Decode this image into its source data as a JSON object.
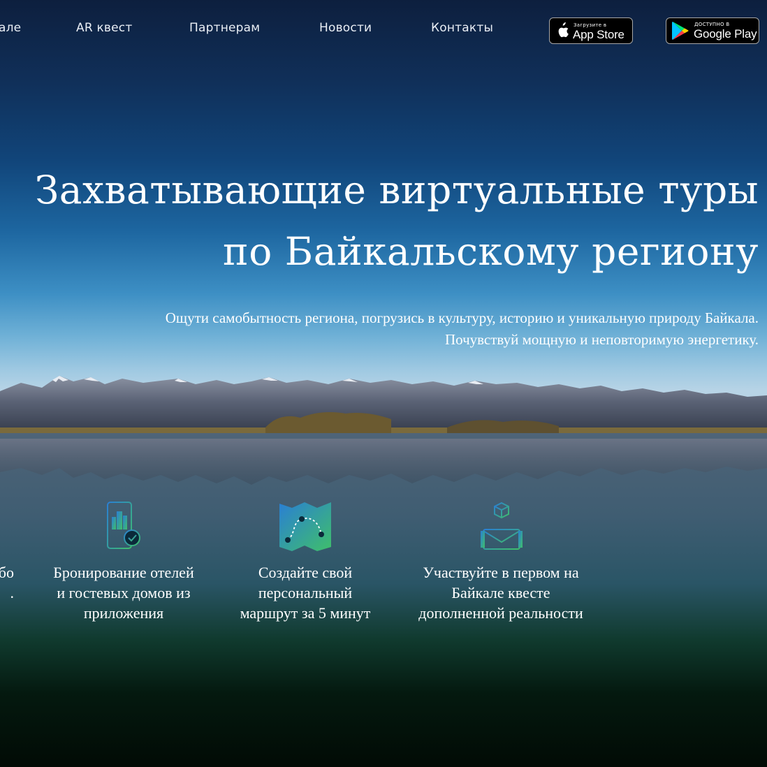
{
  "nav": {
    "links": [
      {
        "label": "але"
      },
      {
        "label": "AR квест"
      },
      {
        "label": "Партнерам"
      },
      {
        "label": "Новости"
      },
      {
        "label": "Контакты"
      }
    ],
    "app_store": {
      "small": "Загрузите в",
      "big": "App Store",
      "icon": "apple-icon"
    },
    "google_play": {
      "small": "ДОСТУПНО В",
      "big": "Google Play",
      "icon": "google-play-icon"
    }
  },
  "hero": {
    "headline_line1": "Захватывающие виртуальные туры",
    "headline_line2": "по Байкальскому региону",
    "subtitle_line1": "Ощути самобытность региона, погрузись в культуру, историю и уникальную природу Байкала.",
    "subtitle_line2": "Почувствуй мощную и неповторимую энергетику."
  },
  "features": [
    {
      "icon": "partial-feature-icon",
      "lines": [
        "бо",
        "."
      ]
    },
    {
      "icon": "hotel-booking-phone-icon",
      "lines": [
        "Бронирование отелей",
        "и гостевых домов из",
        "приложения"
      ]
    },
    {
      "icon": "route-map-icon",
      "lines": [
        "Создайте свой",
        "персональный",
        "маршрут за 5 минут"
      ]
    },
    {
      "icon": "ar-quest-box-icon",
      "lines": [
        "Участвуйте в первом на",
        "Байкале квесте",
        "дополненной реальности"
      ]
    }
  ],
  "colors": {
    "icon_gradient_start": "#2a7fd4",
    "icon_gradient_end": "#3fbf6a",
    "background_bottom": "#020b05"
  }
}
